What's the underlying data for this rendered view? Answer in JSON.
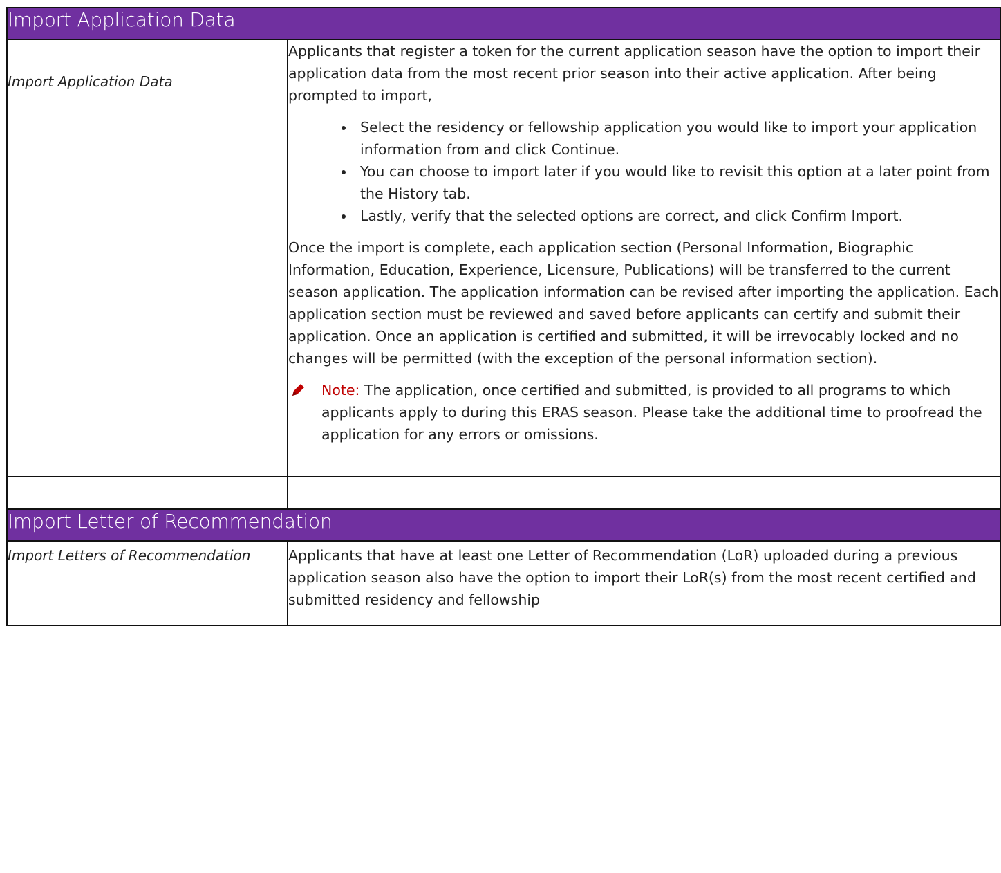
{
  "section1": {
    "header": "Import Application Data",
    "label": "Import Application Data",
    "intro": "Applicants that register a token for the current application season have the option to import their application data from the most recent prior season into their active application. After being prompted to import,",
    "bullets": [
      "Select the residency or fellowship application you would like to import your application information from and click Continue.",
      "You can choose to import later if you would like to revisit this option at a later point from the History tab.",
      "Lastly, verify that the selected options are correct, and click Confirm Import."
    ],
    "paragraph": "Once the import is complete, each application section (Personal Information, Biographic Information, Education, Experience, Licensure, Publications) will be transferred to the current season application. The application information can be revised after importing the application. Each application section must be reviewed and saved before applicants can certify and submit their application. Once an application is certified and submitted, it will be irrevocably locked and no changes will be permitted (with the exception of the personal information section).",
    "note_label": "Note:",
    "note_text": " The application, once certified and submitted, is provided to all programs to which applicants apply to during this ERAS season. Please take the additional time to proofread the application for any errors or omissions.",
    "note_icon": "pencil-icon",
    "note_color": "#c00000"
  },
  "section2": {
    "header": "Import Letter of Recommendation",
    "label": "Import Letters of Recommendation",
    "text": "Applicants that have at least one Letter of Recommendation (LoR) uploaded during a previous application season also have the option to import their LoR(s) from the most recent certified and submitted residency and fellowship"
  },
  "colors": {
    "header_bg": "#7030a0",
    "header_text": "#ffffff",
    "border": "#111111"
  }
}
